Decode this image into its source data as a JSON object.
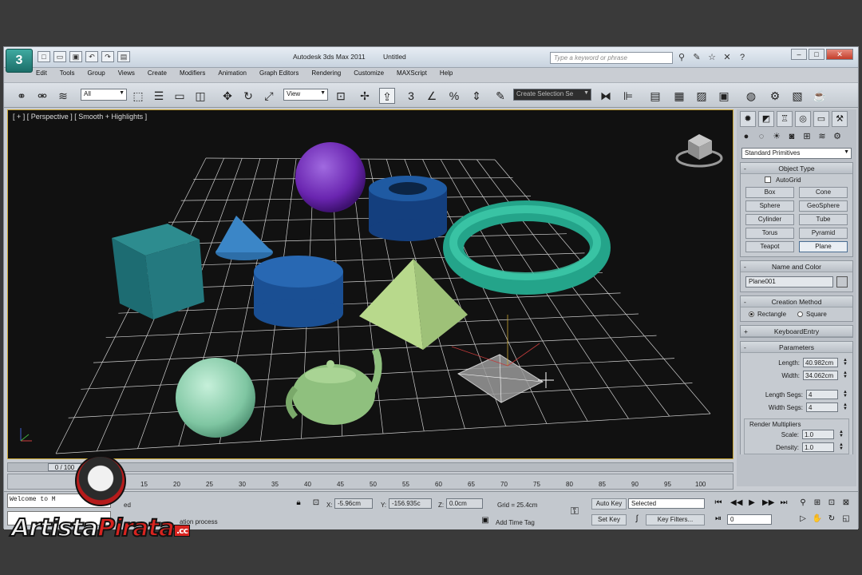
{
  "window": {
    "app_name": "Autodesk 3ds Max  2011",
    "doc_name": "Untitled",
    "search_placeholder": "Type a keyword or phrase",
    "logo": "3"
  },
  "menu": [
    "Edit",
    "Tools",
    "Group",
    "Views",
    "Create",
    "Modifiers",
    "Animation",
    "Graph Editors",
    "Rendering",
    "Customize",
    "MAXScript",
    "Help"
  ],
  "toolbar": {
    "filter_value": "All",
    "refcoord_value": "View",
    "selection_set_value": "Create Selection Se",
    "snap_label": "3"
  },
  "viewport": {
    "label": "[ + ] [ Perspective ] [ Smooth + Highlights ]"
  },
  "command_panel": {
    "category_dropdown": "Standard Primitives",
    "object_type_title": "Object Type",
    "autogrid_label": "AutoGrid",
    "object_buttons": [
      "Box",
      "Cone",
      "Sphere",
      "GeoSphere",
      "Cylinder",
      "Tube",
      "Torus",
      "Pyramid",
      "Teapot",
      "Plane"
    ],
    "name_color_title": "Name and Color",
    "object_name": "Plane001",
    "creation_method_title": "Creation Method",
    "creation_rect": "Rectangle",
    "creation_square": "Square",
    "keyboard_entry_title": "KeyboardEntry",
    "parameters_title": "Parameters",
    "length_label": "Length:",
    "length_value": "40.982cm",
    "width_label": "Width:",
    "width_value": "34.062cm",
    "length_segs_label": "Length Segs:",
    "length_segs_value": "4",
    "width_segs_label": "Width Segs:",
    "width_segs_value": "4",
    "render_mult_title": "Render Multipliers",
    "scale_label": "Scale:",
    "scale_value": "1.0",
    "density_label": "Density:",
    "density_value": "1.0"
  },
  "timeline": {
    "frame_display": "0 / 100",
    "ticks": [
      "15",
      "20",
      "25",
      "30",
      "35",
      "40",
      "45",
      "50",
      "55",
      "60",
      "65",
      "70",
      "75",
      "80",
      "85",
      "90",
      "95",
      "100"
    ]
  },
  "status": {
    "listener_text": "Welcome to M",
    "selected_text": "ed",
    "prompt_text": "ation process",
    "x_label": "X:",
    "x_value": "-5.96cm",
    "y_label": "Y:",
    "y_value": "-156.935c",
    "z_label": "Z:",
    "z_value": "0.0cm",
    "grid_text": "Grid = 25.4cm",
    "add_time_tag": "Add Time Tag",
    "auto_key": "Auto Key",
    "set_key": "Set Key",
    "key_mode_value": "Selected",
    "key_filters": "Key Filters...",
    "frame_value": "0"
  },
  "watermark": {
    "word1": "Artista",
    "word2": "Pirata",
    "suffix": ".cc"
  },
  "colors": {
    "viewport_bg": "#111111",
    "grid": "#d8d8d8",
    "teal": "#2a8a8a",
    "purple": "#7a30c0",
    "blue": "#1f4f8f",
    "mint": "#8fd0b0",
    "pale_green": "#b7d98a",
    "torus": "#2fb89a"
  }
}
